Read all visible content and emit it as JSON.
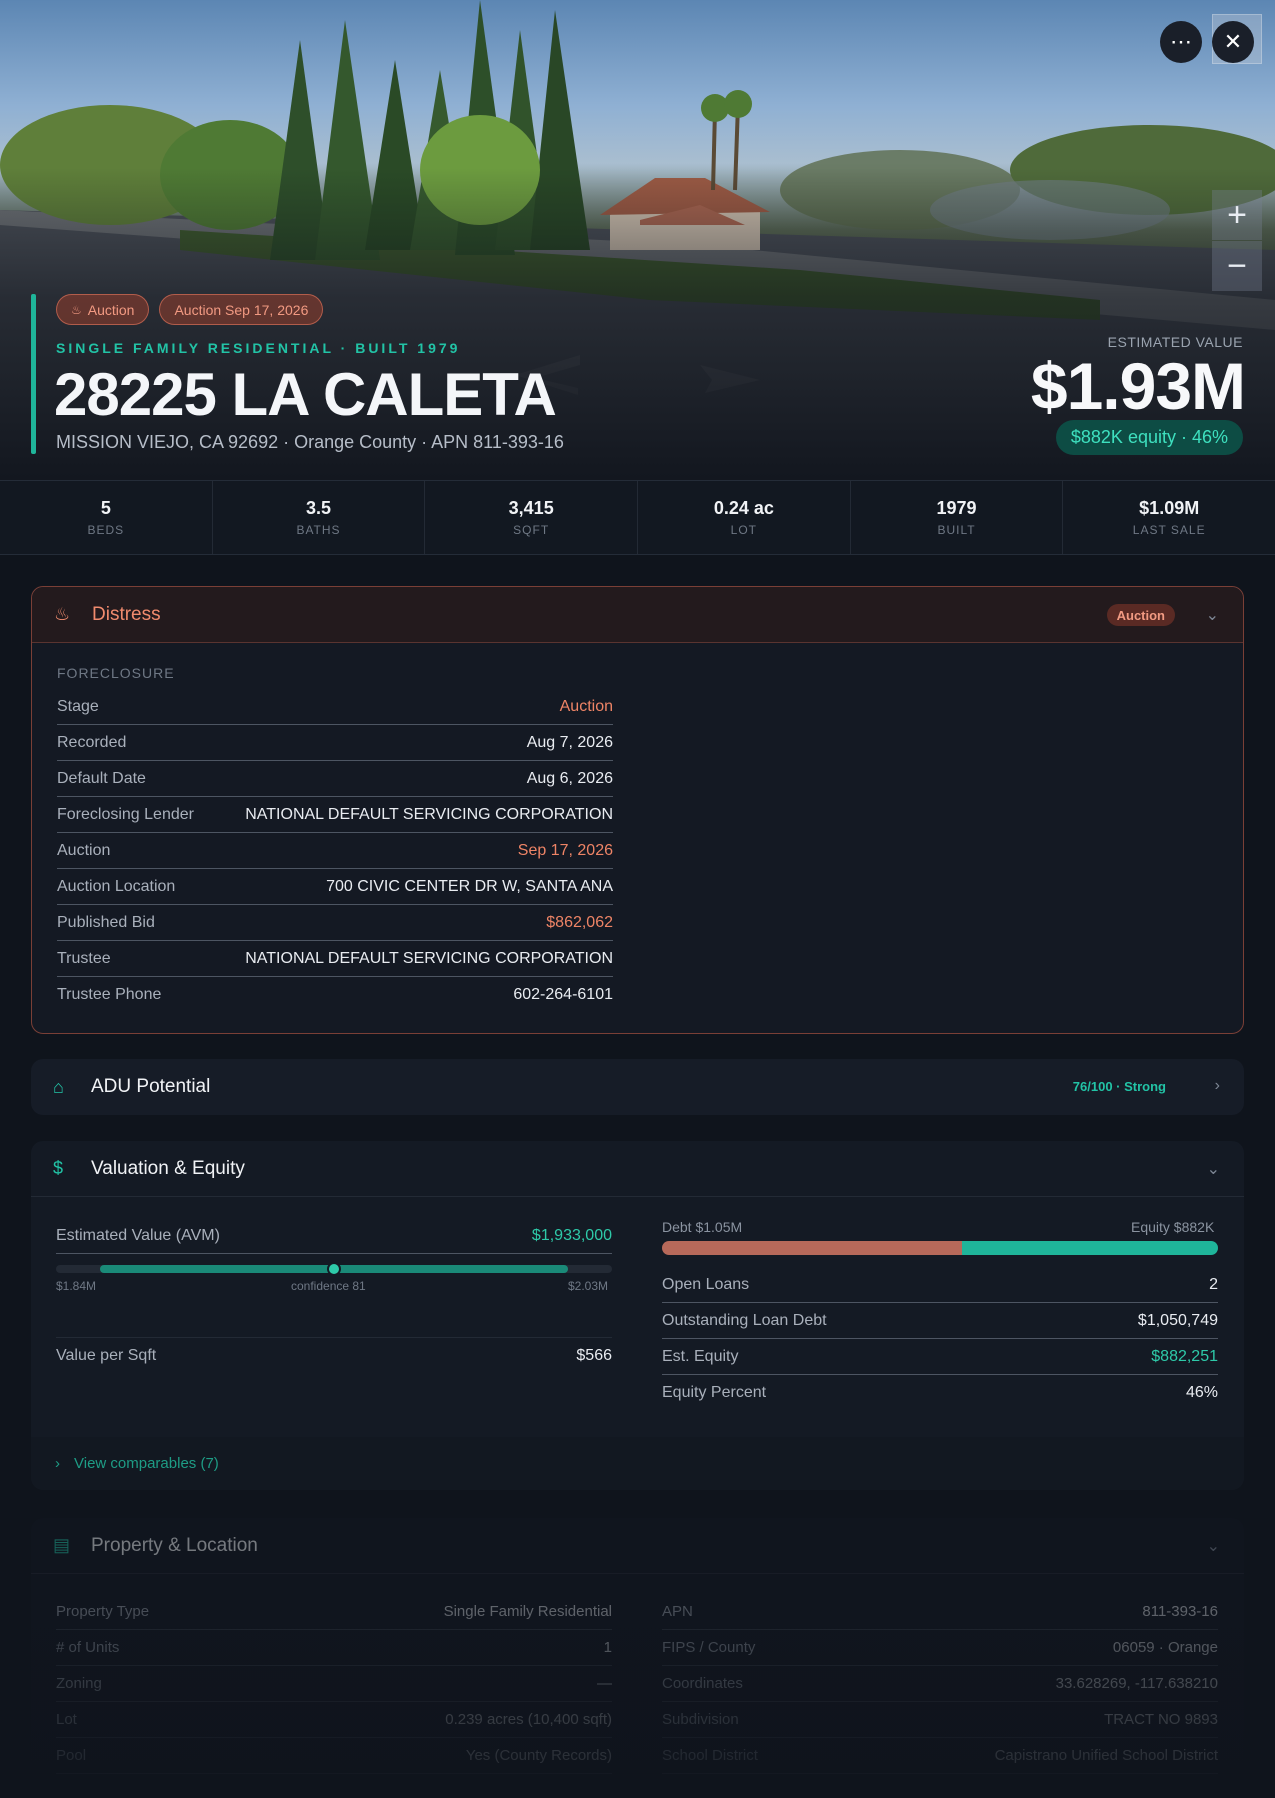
{
  "hero": {
    "chips": [
      "Auction",
      "Auction Sep 17, 2026"
    ],
    "subtype": "SINGLE FAMILY RESIDENTIAL · BUILT 1979",
    "address": "28225 LA CALETA",
    "location": "MISSION VIEJO, CA 92692 · Orange County · APN 811-393-16",
    "estimate_label": "ESTIMATED VALUE",
    "estimate_value": "$1.93M",
    "equity_pill": "$882K equity · 46%",
    "icons": {
      "more": "more-icon",
      "close": "close-icon",
      "zoom_in": "plus-icon",
      "zoom_out": "minus-icon"
    }
  },
  "stats": [
    {
      "value": "5",
      "label": "BEDS"
    },
    {
      "value": "3.5",
      "label": "BATHS"
    },
    {
      "value": "3,415",
      "label": "SQFT"
    },
    {
      "value": "0.24 ac",
      "label": "LOT"
    },
    {
      "value": "1979",
      "label": "BUILT"
    },
    {
      "value": "$1.09M",
      "label": "LAST SALE"
    }
  ],
  "distress": {
    "title": "Distress",
    "badge": "Auction",
    "section": "FORECLOSURE",
    "rows": [
      {
        "k": "Stage",
        "v": "Auction"
      },
      {
        "k": "Recorded",
        "v": "Aug 7, 2026"
      },
      {
        "k": "Default Date",
        "v": "Aug 6, 2026"
      },
      {
        "k": "Foreclosing Lender",
        "v": "NATIONAL DEFAULT SERVICING CORPORATION"
      },
      {
        "k": "Auction",
        "v": "Sep 17, 2026"
      },
      {
        "k": "Auction Location",
        "v": "700 CIVIC CENTER DR W, SANTA ANA"
      },
      {
        "k": "Published Bid",
        "v": "$862,062"
      },
      {
        "k": "Trustee",
        "v": "NATIONAL DEFAULT SERVICING CORPORATION"
      },
      {
        "k": "Trustee Phone",
        "v": "602-264-6101"
      }
    ]
  },
  "adu": {
    "title": "ADU Potential",
    "score": "76/100 · Strong"
  },
  "valuation": {
    "title": "Valuation & Equity",
    "avm_label": "Estimated Value (AVM)",
    "avm_value": "$1,933,000",
    "range_low": "$1.84M",
    "range_high": "$2.03M",
    "confidence": "confidence 81",
    "value_per_sqft_label": "Value per Sqft",
    "value_per_sqft": "$566",
    "debt_label": "Debt $1.05M",
    "equity_label": "Equity $882K",
    "debt_share": 0.54,
    "rows": [
      {
        "k": "Open Loans",
        "v": "2"
      },
      {
        "k": "Outstanding Loan Debt",
        "v": "$1,050,749"
      },
      {
        "k": "Est. Equity",
        "v": "$882,251"
      },
      {
        "k": "Equity Percent",
        "v": "46%"
      }
    ],
    "comparables": "View comparables (7)"
  },
  "property": {
    "title": "Property & Location",
    "left": [
      {
        "k": "Property Type",
        "v": "Single Family Residential"
      },
      {
        "k": "# of Units",
        "v": "1"
      },
      {
        "k": "Zoning",
        "v": "—"
      },
      {
        "k": "Lot",
        "v": "0.239 acres (10,400 sqft)"
      },
      {
        "k": "Pool",
        "v": "Yes (County Records)"
      }
    ],
    "right": [
      {
        "k": "APN",
        "v": "811-393-16"
      },
      {
        "k": "FIPS / County",
        "v": "06059 · Orange"
      },
      {
        "k": "Coordinates",
        "v": "33.628269, -117.638210"
      },
      {
        "k": "Subdivision",
        "v": "TRACT NO 9893"
      },
      {
        "k": "School District",
        "v": "Capistrano Unified School District"
      }
    ]
  },
  "colors": {
    "accent": "#1fb59a",
    "distress": "#ee8466",
    "background": "#0f141c"
  }
}
